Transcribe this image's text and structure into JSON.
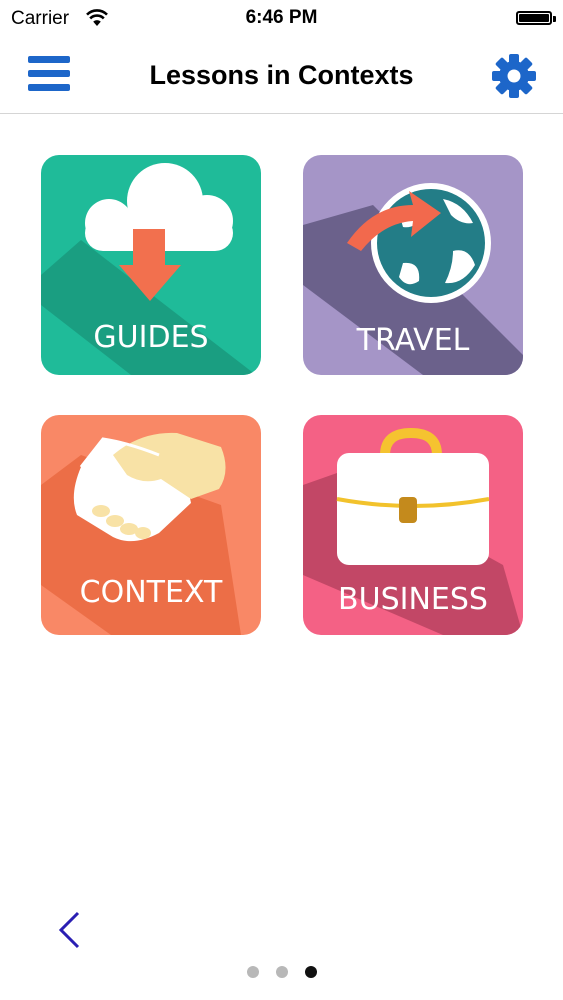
{
  "status_bar": {
    "carrier": "Carrier",
    "time": "6:46 PM",
    "wifi_icon": "wifi-icon",
    "battery_icon": "battery-icon"
  },
  "nav": {
    "title": "Lessons in Contexts",
    "menu_icon": "hamburger-menu-icon",
    "settings_icon": "gear-icon",
    "accent_color": "#1d66c9"
  },
  "tiles": [
    {
      "label": "GUIDES",
      "icon": "cloud-download-icon",
      "color": "#1fbb99"
    },
    {
      "label": "TRAVEL",
      "icon": "globe-arrow-icon",
      "color": "#a595c7"
    },
    {
      "label": "CONTEXT",
      "icon": "handshake-icon",
      "color": "#f98866"
    },
    {
      "label": "BUSINESS",
      "icon": "briefcase-icon",
      "color": "#f46185"
    }
  ],
  "footer": {
    "back_icon": "chevron-left-icon",
    "back_color": "#2a1fb3",
    "pages": {
      "count": 3,
      "current": 3
    }
  }
}
